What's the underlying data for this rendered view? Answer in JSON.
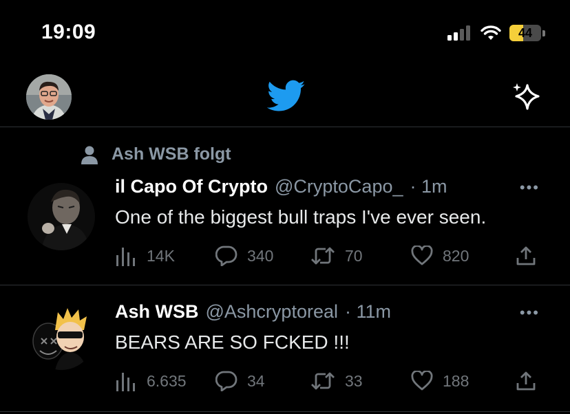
{
  "status_bar": {
    "time": "19:09",
    "battery": "44",
    "battery_level": 0.44,
    "signal_icon": "signal-bars-icon",
    "wifi_icon": "wifi-icon"
  },
  "header": {
    "logo_icon": "twitter-bird-icon",
    "timeline_icon": "sparkle-icon",
    "avatar": "profile-avatar"
  },
  "colors": {
    "accent": "#1d9bf0",
    "background": "#000000",
    "muted": "#71767b",
    "battery": "#f5cf3a"
  },
  "tweets": [
    {
      "social_context": "Ash WSB folgt",
      "name": "il Capo Of Crypto",
      "handle": "@CryptoCapo_",
      "time": "· 1m",
      "text": "One of the biggest bull traps I've ever seen.",
      "views": "14K",
      "replies": "340",
      "retweets": "70",
      "likes": "820"
    },
    {
      "name": "Ash WSB",
      "handle": "@Ashcryptoreal",
      "time": "· 11m",
      "text": "BEARS ARE SO FCKED !!!",
      "views": "6.635",
      "replies": "34",
      "retweets": "33",
      "likes": "188"
    }
  ]
}
